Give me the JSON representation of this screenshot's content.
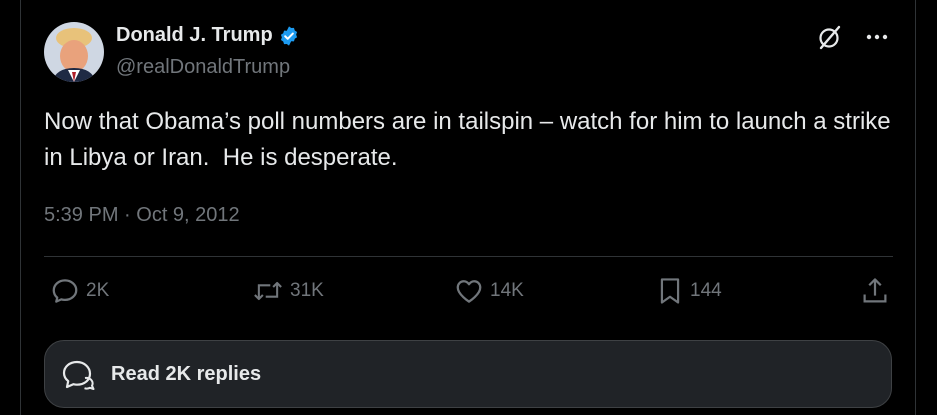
{
  "author": {
    "name": "Donald J. Trump",
    "handle": "@realDonaldTrump"
  },
  "tweet": {
    "text": "Now that Obama’s poll numbers are in tailspin – watch for him to launch a strike in Libya or Iran.  He is desperate.",
    "timestamp": "5:39 PM · Oct 9, 2012"
  },
  "actions": {
    "replies": "2K",
    "retweets": "31K",
    "likes": "14K",
    "bookmarks": "144"
  },
  "read_replies_label": "Read 2K replies",
  "colors": {
    "background": "#000000",
    "text": "#e7e9ea",
    "muted": "#71767b",
    "verified": "#1d9bf0",
    "divider": "#2f3336",
    "reply_bar": "#202327"
  },
  "icons": [
    "verified-badge-icon",
    "grok-icon",
    "more-icon",
    "reply-icon",
    "retweet-icon",
    "like-icon",
    "bookmark-icon",
    "share-icon",
    "replies-bubble-icon"
  ]
}
